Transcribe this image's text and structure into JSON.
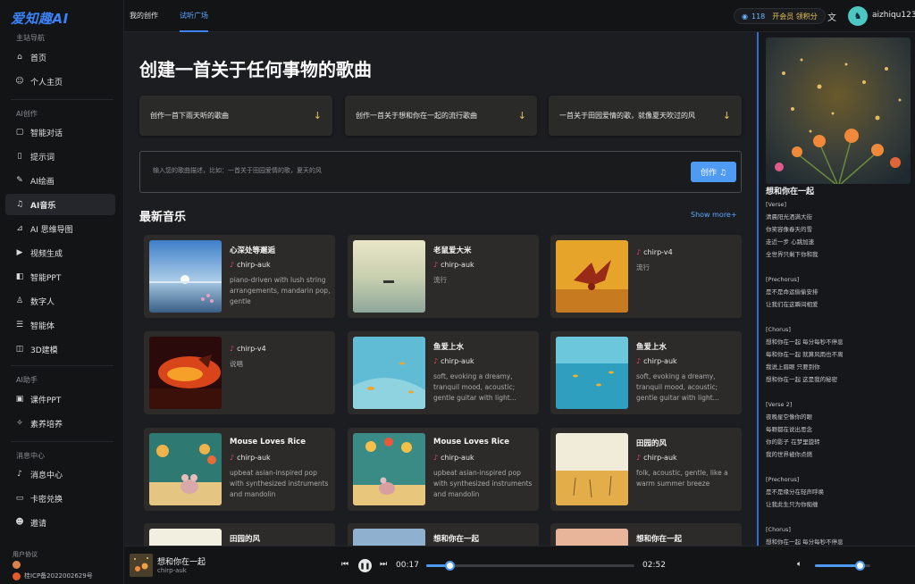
{
  "app": {
    "logo": "爱知趣AI"
  },
  "sidebar": {
    "sections": [
      {
        "label": "主站导航",
        "items": [
          {
            "label": "首页",
            "icon": "home-icon",
            "glyph": "⌂"
          },
          {
            "label": "个人主页",
            "icon": "user-icon",
            "glyph": "☺"
          }
        ]
      },
      {
        "label": "AI创作",
        "items": [
          {
            "label": "智能对话",
            "icon": "chat-icon",
            "glyph": "▢"
          },
          {
            "label": "提示词",
            "icon": "bookmark-icon",
            "glyph": "▯"
          },
          {
            "label": "AI绘画",
            "icon": "brush-icon",
            "glyph": "✎"
          },
          {
            "label": "AI音乐",
            "icon": "music-icon",
            "glyph": "♫",
            "active": true
          },
          {
            "label": "AI 思维导图",
            "icon": "chart-icon",
            "glyph": "⊿"
          },
          {
            "label": "视频生成",
            "icon": "video-icon",
            "glyph": "▶"
          },
          {
            "label": "智能PPT",
            "icon": "ppt-icon",
            "glyph": "◧"
          },
          {
            "label": "数字人",
            "icon": "avatar-person-icon",
            "glyph": "♙"
          },
          {
            "label": "智能体",
            "icon": "list-icon",
            "glyph": "☰"
          },
          {
            "label": "3D建模",
            "icon": "cube-icon",
            "glyph": "◫"
          }
        ]
      },
      {
        "label": "AI助手",
        "items": [
          {
            "label": "课件PPT",
            "icon": "slides-icon",
            "glyph": "▣"
          },
          {
            "label": "素养培养",
            "icon": "sparkle-icon",
            "glyph": "✧"
          }
        ]
      },
      {
        "label": "消息中心",
        "items": [
          {
            "label": "消息中心",
            "icon": "bell-icon",
            "glyph": "♪"
          },
          {
            "label": "卡密兑换",
            "icon": "card-icon",
            "glyph": "▭"
          },
          {
            "label": "邀请",
            "icon": "invite-icon",
            "glyph": "☻"
          }
        ]
      }
    ],
    "footer": {
      "label": "用户协议",
      "icp": "桂ICP备2022002629号"
    }
  },
  "topbar": {
    "tabs": [
      {
        "label": "我的创作"
      },
      {
        "label": "试听广场",
        "active": true
      }
    ],
    "credits_count": "118",
    "credits_label": "开会员 领积分",
    "translate_glyph": "文",
    "username": "aizhiqu123"
  },
  "main": {
    "hero": "创建一首关于任何事物的歌曲",
    "suggestions": [
      "创作一首下雨天听的歌曲",
      "创作一首关于想和你在一起的流行歌曲",
      "一首关于田园爱情的歌，就像夏天吹过的风"
    ],
    "prompt_placeholder": "输入您的歌曲描述，比如：一首关于田园爱情的歌，夏天的风",
    "create_label": "创作 ♫",
    "section_title": "最新音乐",
    "show_more": "Show more+",
    "songs": [
      {
        "title": "心深处等邂逅",
        "model": "chirp-auk",
        "desc": "piano-driven with lush string arrangements, mandarin pop, gentle",
        "art": "lake"
      },
      {
        "title": "老鼠爱大米",
        "model": "chirp-auk",
        "desc": "流行",
        "art": "calm"
      },
      {
        "title": "",
        "model": "chirp-v4",
        "desc": "流行",
        "art": "dragon"
      },
      {
        "title": "",
        "model": "chirp-v4",
        "desc": "说唱",
        "art": "fire"
      },
      {
        "title": "鱼爱上水",
        "model": "chirp-auk",
        "desc": "soft, evoking a dreamy, tranquil mood, acoustic; gentle guitar with light...",
        "art": "fish"
      },
      {
        "title": "鱼爱上水",
        "model": "chirp-auk",
        "desc": "soft, evoking a dreamy, tranquil mood, acoustic; gentle guitar with light...",
        "art": "fish2"
      },
      {
        "title": "Mouse Loves Rice",
        "model": "chirp-auk",
        "desc": "upbeat asian-inspired pop with synthesized instruments and mandolin",
        "art": "mouse"
      },
      {
        "title": "Mouse Loves Rice",
        "model": "chirp-auk",
        "desc": "upbeat asian-inspired pop with synthesized instruments and mandolin",
        "art": "mouse2"
      },
      {
        "title": "田园的风",
        "model": "chirp-auk",
        "desc": "folk, acoustic, gentle, like a warm summer breeze",
        "art": "field"
      },
      {
        "title": "田园的风",
        "model": "",
        "desc": "",
        "art": "field2"
      },
      {
        "title": "想和你在一起",
        "model": "",
        "desc": "",
        "art": "sky"
      },
      {
        "title": "想和你在一起",
        "model": "",
        "desc": "",
        "art": "sunset"
      }
    ]
  },
  "right_panel": {
    "title": "想和你在一起",
    "lyrics": "[Verse]\n清晨阳光洒满大街\n你笑容像春天的雪\n走近一步 心跳加速\n全世界只剩下你和我\n\n[Prechorus]\n是不是命运偷偷安排\n让我们在这瞬间相爱\n\n[Chorus]\n想和你在一起 每分每秒不停息\n每和你在一起 就算风雨也不离\n我说上眉眼 只要到你\n想和你在一起 这是我的秘密\n\n[Verse 2]\n夜晚星空像你的眼\n每颗都在说出思念\n你的影子 在梦里旋转\n我的世界被你点燃\n\n[Prechorus]\n是不是缘分在轻声呼唤\n让我此生只为你痴缠\n\n[Chorus]\n想和你在一起 每分每秒不停息"
  },
  "player": {
    "title": "想和你在一起",
    "artist": "chirp-auk",
    "current_time": "00:17",
    "total_time": "02:52",
    "progress": 0.11,
    "volume": 0.8
  }
}
